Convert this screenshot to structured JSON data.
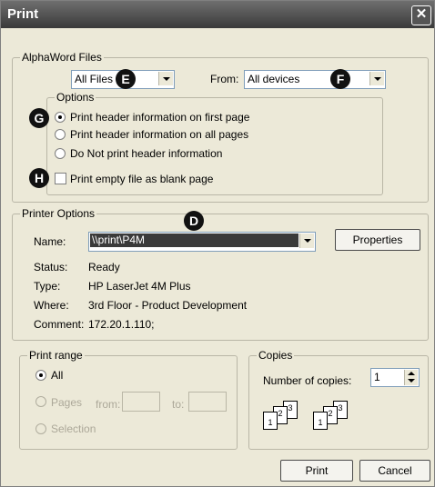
{
  "window": {
    "title": "Print",
    "close_glyph": "✕"
  },
  "alphaword": {
    "legend": "AlphaWord Files",
    "files_value": "All Files",
    "from_label": "From:",
    "from_value": "All devices",
    "markers": {
      "e": "E",
      "f": "F",
      "g": "G",
      "h": "H"
    },
    "options": {
      "legend": "Options",
      "radio_first": "Print header information on first page",
      "radio_all": "Print header information on all pages",
      "radio_none": "Do Not print header information"
    },
    "empty_checkbox": "Print empty file as blank page"
  },
  "printer": {
    "legend": "Printer Options",
    "marker": "D",
    "name_label": "Name:",
    "name_value": "\\\\print\\P4M",
    "properties_button": "Properties",
    "status_label": "Status:",
    "status_value": "Ready",
    "type_label": "Type:",
    "type_value": "HP LaserJet 4M Plus",
    "where_label": "Where:",
    "where_value": "3rd Floor - Product Development",
    "comment_label": "Comment:",
    "comment_value": "172.20.1.110;"
  },
  "range": {
    "legend": "Print range",
    "all": "All",
    "pages": "Pages",
    "from": "from:",
    "to": "to:",
    "selection": "Selection"
  },
  "copies": {
    "legend": "Copies",
    "number_label": "Number of copies:",
    "number_value": "1",
    "doc_labels": [
      "1",
      "2",
      "3"
    ]
  },
  "buttons": {
    "print": "Print",
    "cancel": "Cancel"
  }
}
